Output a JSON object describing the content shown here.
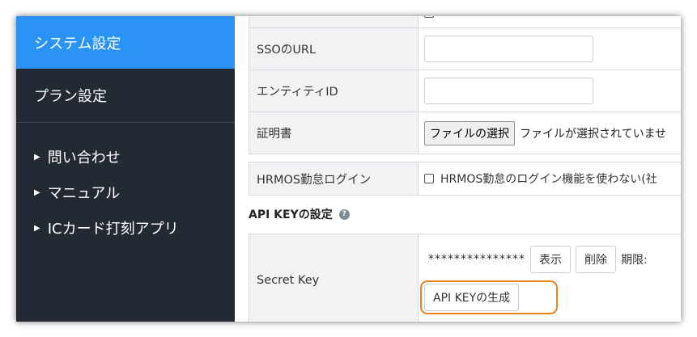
{
  "sidebar": {
    "system_settings": "システム設定",
    "plan_settings": "プラン設定",
    "links": [
      {
        "label": "問い合わせ"
      },
      {
        "label": "マニュアル"
      },
      {
        "label": "ICカード打刻アプリ"
      }
    ],
    "active_color": "#2b93f5",
    "bg_color": "#232a33"
  },
  "sso": {
    "url_label": "SSOのURL",
    "url_value": "",
    "entity_label": "エンティティID",
    "entity_value": "",
    "cert_label": "証明書",
    "file_button": "ファイルの選択",
    "file_status": "ファイルが選択されていませ"
  },
  "hrmos": {
    "label": "HRMOS勤怠ログイン",
    "checkbox_label": "HRMOS勤怠のログイン機能を使わない(社",
    "checked": false
  },
  "apikey": {
    "section_title": "API KEYの設定",
    "help_icon": "question-circle-icon",
    "secret_label": "Secret Key",
    "masked_value": "***************",
    "show_button": "表示",
    "delete_button": "削除",
    "expiry_label": "期限:",
    "generate_button": "API KEYの生成",
    "highlight_color": "#e8831c"
  }
}
